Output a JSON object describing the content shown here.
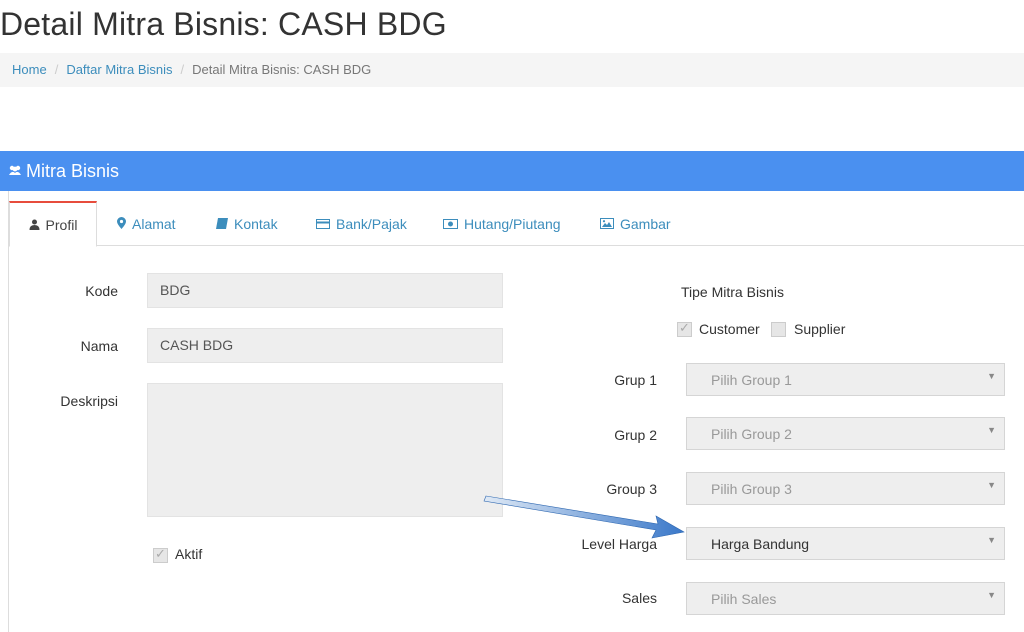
{
  "page": {
    "title": "Detail Mitra Bisnis: CASH BDG"
  },
  "breadcrumb": {
    "home": "Home",
    "list": "Daftar Mitra Bisnis",
    "current": "Detail Mitra Bisnis: CASH BDG",
    "sep": "/"
  },
  "panel": {
    "title": "Mitra Bisnis",
    "icon": "users-icon"
  },
  "tabs": [
    {
      "label": "Profil",
      "icon": "user-icon",
      "glyph": "👤"
    },
    {
      "label": "Alamat",
      "icon": "map-marker-icon",
      "glyph": "📍"
    },
    {
      "label": "Kontak",
      "icon": "book-icon",
      "glyph": "📘"
    },
    {
      "label": "Bank/Pajak",
      "icon": "credit-card-icon",
      "glyph": "▭"
    },
    {
      "label": "Hutang/Piutang",
      "icon": "money-icon",
      "glyph": "▣"
    },
    {
      "label": "Gambar",
      "icon": "image-icon",
      "glyph": "🖼"
    }
  ],
  "form": {
    "kode": {
      "label": "Kode",
      "value": "BDG"
    },
    "nama": {
      "label": "Nama",
      "value": "CASH BDG"
    },
    "deskripsi": {
      "label": "Deskripsi",
      "value": ""
    },
    "aktif": {
      "label": "Aktif",
      "checked": true
    }
  },
  "tipe": {
    "label": "Tipe Mitra Bisnis",
    "customer": {
      "label": "Customer",
      "checked": true
    },
    "supplier": {
      "label": "Supplier",
      "checked": false
    }
  },
  "selects": {
    "group1": {
      "label": "Grup 1",
      "value": "Pilih Group 1"
    },
    "group2": {
      "label": "Grup 2",
      "value": "Pilih Group 2"
    },
    "group3": {
      "label": "Group 3",
      "value": "Pilih Group 3"
    },
    "level_harga": {
      "label": "Level Harga",
      "value": "Harga Bandung"
    },
    "sales": {
      "label": "Sales",
      "value": "Pilih Sales"
    }
  },
  "caret": "▼",
  "colors": {
    "header": "#4a90f0",
    "link": "#3c8dbc",
    "active_tab_border": "#e74c3c",
    "arrow": "#3a78c9"
  }
}
